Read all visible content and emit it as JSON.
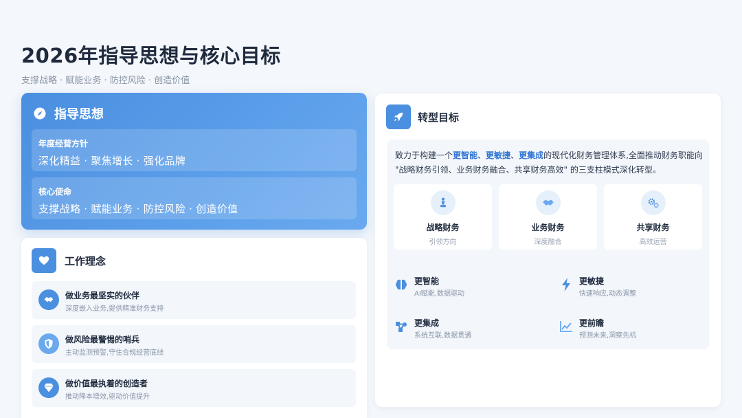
{
  "page": {
    "title": "2026年指导思想与核心目标",
    "subtitle": "支撑战略 · 赋能业务 · 防控风险 · 创造价值"
  },
  "colors": {
    "primary": "#4a8fe0",
    "accent_text": "#2f74d4",
    "background": "#f4f7fb"
  },
  "guiding": {
    "title": "指导思想",
    "icon": "compass-icon",
    "rows": [
      {
        "label": "年度经营方针",
        "value": "深化精益 · 聚焦增长 · 强化品牌"
      },
      {
        "label": "核心使命",
        "value": "支撑战略 · 赋能业务 · 防控风险 · 创造价值"
      }
    ]
  },
  "work": {
    "title": "工作理念",
    "icon": "heart-icon",
    "items": [
      {
        "title": "做业务最坚实的伙伴",
        "desc": "深度嵌入业务,提供精准财务支持",
        "icon": "handshake-icon"
      },
      {
        "title": "做风险最警惕的哨兵",
        "desc": "主动监测预警,守住合规经营底线",
        "icon": "shield-icon"
      },
      {
        "title": "做价值最执着的创造者",
        "desc": "推动降本增效,驱动价值提升",
        "icon": "gem-icon"
      }
    ]
  },
  "transformation": {
    "title": "转型目标",
    "icon": "rocket-icon",
    "desc": {
      "p1": "致力于构建一个",
      "h1": "更智能",
      "s1": "、",
      "h2": "更敏捷",
      "s2": "、",
      "h3": "更集成",
      "p2": "的现代化财务管理体系,全面推动财务职能向 \"战略财务引领、业务财务融合、共享财务高效\" 的三支柱模式深化转型。"
    },
    "pillars": [
      {
        "title": "战略财务",
        "sub": "引领方向",
        "icon": "chess-icon"
      },
      {
        "title": "业务财务",
        "sub": "深度融合",
        "icon": "handshake-icon"
      },
      {
        "title": "共享财务",
        "sub": "高效运营",
        "icon": "gears-icon"
      }
    ],
    "features": [
      {
        "title": "更智能",
        "desc": "AI赋能,数据驱动",
        "icon": "brain-icon"
      },
      {
        "title": "更敏捷",
        "desc": "快速响应,动态调整",
        "icon": "bolt-icon"
      },
      {
        "title": "更集成",
        "desc": "系统互联,数据贯通",
        "icon": "network-icon"
      },
      {
        "title": "更前瞻",
        "desc": "预测未来,洞察先机",
        "icon": "trend-chart-icon"
      }
    ]
  }
}
